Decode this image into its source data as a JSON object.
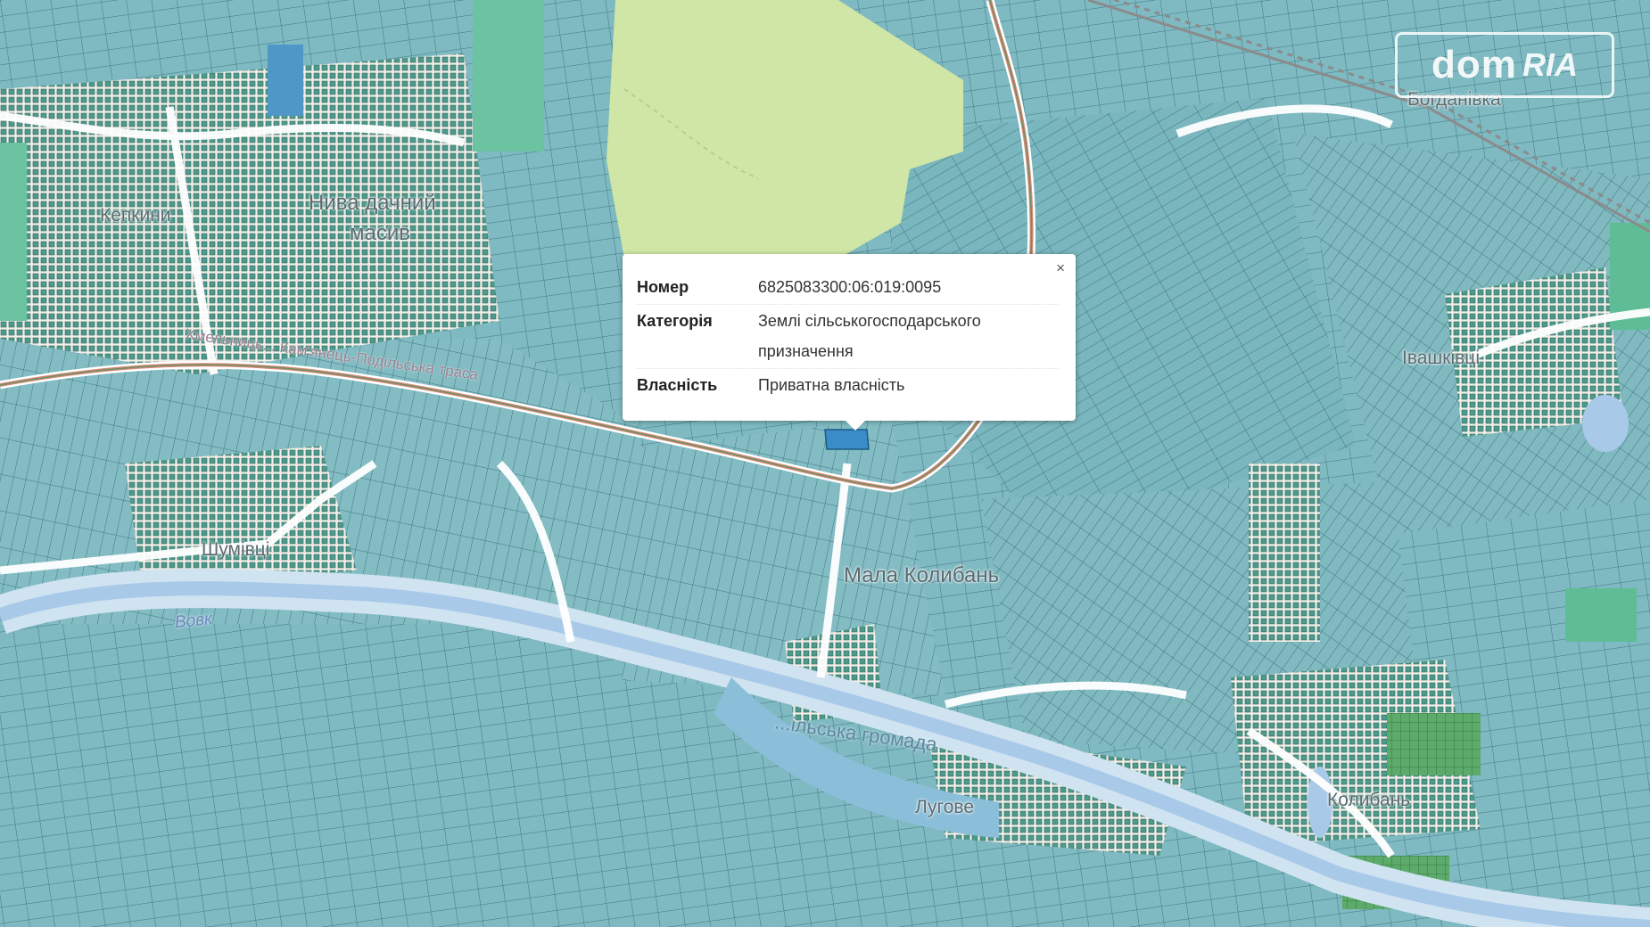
{
  "map": {
    "places": {
      "niva": "Нива дачний масив",
      "niva_line1": "Нива дачний",
      "niva_line2": "масив",
      "kenkyn": "Кепкини",
      "shumivtsi": "Шумівці",
      "mala_kolyban": "Мала Колибань",
      "ivashkivtsi": "Івашківці",
      "kolyban": "Колибань",
      "luhove": "Лугове",
      "bohdanivka": "Богданівка"
    },
    "river": "Вовк",
    "community": "...ільська громада",
    "road": "Хмельниць... Кам'янець-Подільська траса"
  },
  "popup": {
    "close_label": "×",
    "rows": [
      {
        "key": "Номер",
        "value": "6825083300:06:019:0095"
      },
      {
        "key": "Категорія",
        "value_line1": "Землі сільськогосподарського",
        "value_line2": "призначення"
      },
      {
        "key": "Власність",
        "value": "Приватна власність"
      }
    ]
  },
  "watermark": {
    "dom": "dom",
    "ria": "RIA"
  },
  "colors": {
    "parcel_fill": "#7fb9c1",
    "parcel_stroke": "#3b6f78",
    "background": "#f4f1ea",
    "forest": "#cfe6a6",
    "river": "#a9c9e9",
    "road": "#d78a73"
  }
}
